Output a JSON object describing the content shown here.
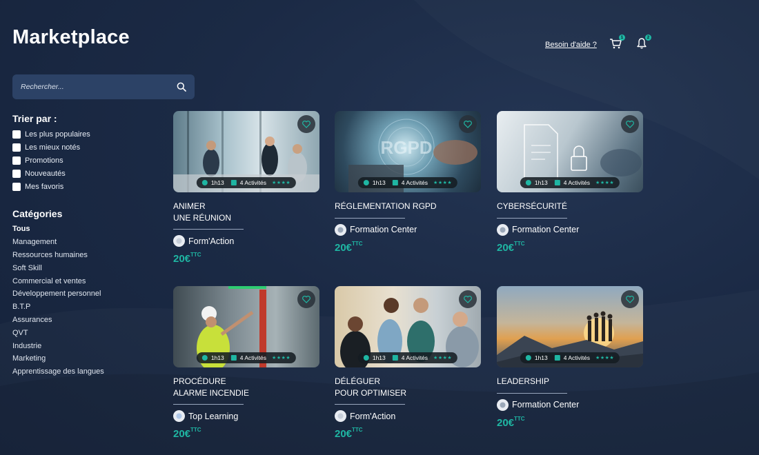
{
  "header": {
    "title": "Marketplace",
    "help_link": "Besoin d'aide ?",
    "cart_badge": "1",
    "notif_badge": "2"
  },
  "search": {
    "placeholder": "Rechercher..."
  },
  "sort": {
    "title": "Trier par :",
    "options": [
      "Les plus populaires",
      "Les mieux notés",
      "Promotions",
      "Nouveautés",
      "Mes favoris"
    ]
  },
  "categories": {
    "title": "Catégories",
    "items": [
      "Tous",
      "Management",
      "Ressources humaines",
      "Soft Skill",
      "Commercial et ventes",
      "Développement personnel",
      "B.T.P",
      "Assurances",
      "QVT",
      "Industrie",
      "Marketing",
      "Apprentissage des langues"
    ]
  },
  "courses": [
    {
      "line1": "ANIMER",
      "line2": "UNE RÉUNION",
      "provider": "Form'Action",
      "price": "20€",
      "price_suffix": "TTC",
      "duration": "1h13",
      "activities": "4 Activités",
      "stars": "★★★★"
    },
    {
      "line1": "RÉGLEMENTATION RGPD",
      "line2": "",
      "provider": "Formation Center",
      "price": "20€",
      "price_suffix": "TTC",
      "duration": "1h13",
      "activities": "4 Activités",
      "stars": "★★★★"
    },
    {
      "line1": "CYBERSÉCURITÉ",
      "line2": "",
      "provider": "Formation Center",
      "price": "20€",
      "price_suffix": "TTC",
      "duration": "1h13",
      "activities": "4 Activités",
      "stars": "★★★★"
    },
    {
      "line1": "PROCÉDURE",
      "line2": "ALARME INCENDIE",
      "provider": "Top Learning",
      "price": "20€",
      "price_suffix": "TTC",
      "duration": "1h13",
      "activities": "4 Activités",
      "stars": "★★★★"
    },
    {
      "line1": "DÉLÉGUER",
      "line2": "POUR OPTIMISER",
      "provider": "Form'Action",
      "price": "20€",
      "price_suffix": "TTC",
      "duration": "1h13",
      "activities": "4 Activités",
      "stars": "★★★★"
    },
    {
      "line1": "LEADERSHIP",
      "line2": "",
      "provider": "Formation Center",
      "price": "20€",
      "price_suffix": "TTC",
      "duration": "1h13",
      "activities": "4 Activités",
      "stars": "★★★★"
    }
  ],
  "colors": {
    "accent": "#1fb6a3",
    "background": "#1b2a45",
    "search_bg": "#2c4266"
  }
}
